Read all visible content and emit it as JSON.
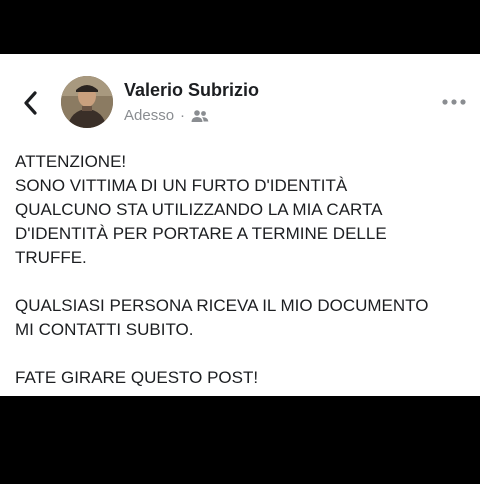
{
  "post": {
    "author": "Valerio Subrizio",
    "timestamp": "Adesso",
    "separator": "·",
    "audience_icon": "friends-icon",
    "body": "ATTENZIONE!\nSONO VITTIMA DI UN FURTO D'IDENTITÀ\nQUALCUNO STA UTILIZZANDO LA MIA CARTA\nD'IDENTITÀ PER PORTARE A TERMINE DELLE\nTRUFFE.\n\nQUALSIASI PERSONA RICEVA IL MIO DOCUMENTO\nMI CONTATTI SUBITO.\n\nFATE GIRARE QUESTO POST!"
  },
  "icons": {
    "back": "chevron-left-icon",
    "more": "more-horizontal-icon"
  },
  "colors": {
    "background": "#000000",
    "card": "#ffffff",
    "text": "#1c1e21",
    "meta": "#8a8d91"
  }
}
